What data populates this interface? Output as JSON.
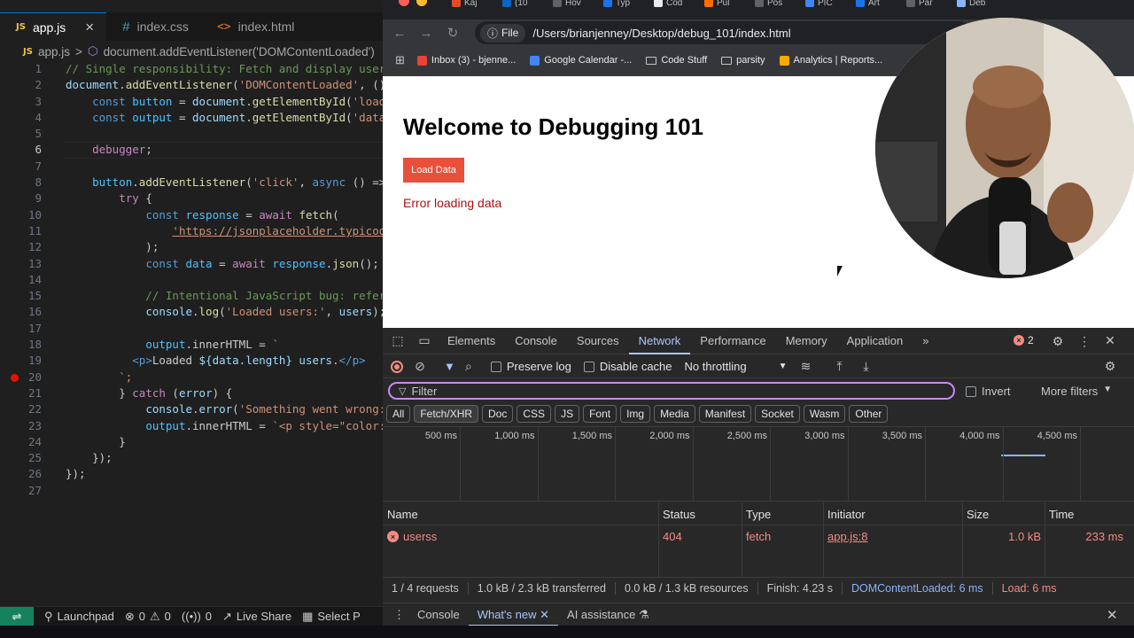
{
  "editor": {
    "tabs": [
      {
        "label": "app.js",
        "icon": "JS",
        "active": true
      },
      {
        "label": "index.css",
        "icon": "#"
      },
      {
        "label": "index.html",
        "icon": "<>"
      }
    ],
    "breadcrumb": {
      "file": "app.js",
      "sep": ">",
      "symbol": "document.addEventListener('DOMContentLoaded')"
    },
    "lines": [
      {
        "n": "1",
        "text": "// Single responsibility: Fetch and display user"
      },
      {
        "n": "2",
        "text": "document.addEventListener('DOMContentLoaded', () "
      },
      {
        "n": "3",
        "text": "    const button = document.getElementById('load-"
      },
      {
        "n": "4",
        "text": "    const output = document.getElementById('data-"
      },
      {
        "n": "5",
        "text": ""
      },
      {
        "n": "6",
        "text": "    debugger;"
      },
      {
        "n": "7",
        "text": ""
      },
      {
        "n": "8",
        "text": "    button.addEventListener('click', async () =>"
      },
      {
        "n": "9",
        "text": "        try {"
      },
      {
        "n": "10",
        "text": "            const response = await fetch("
      },
      {
        "n": "11",
        "text": "                'https://jsonplaceholder.typicode"
      },
      {
        "n": "12",
        "text": "            );"
      },
      {
        "n": "13",
        "text": "            const data = await response.json();"
      },
      {
        "n": "14",
        "text": ""
      },
      {
        "n": "15",
        "text": "            // Intentional JavaScript bug: refere"
      },
      {
        "n": "16",
        "text": "            console.log('Loaded users:', users);"
      },
      {
        "n": "17",
        "text": ""
      },
      {
        "n": "18",
        "text": "            output.innerHTML = `"
      },
      {
        "n": "19",
        "text": "          <p>Loaded ${data.length} users.</p>"
      },
      {
        "n": "20",
        "text": "        `;"
      },
      {
        "n": "21",
        "text": "        } catch (error) {"
      },
      {
        "n": "22",
        "text": "            console.error('Something went wrong:'"
      },
      {
        "n": "23",
        "text": "            output.innerHTML = `<p style=\"color:"
      },
      {
        "n": "24",
        "text": "        }"
      },
      {
        "n": "25",
        "text": "    });"
      },
      {
        "n": "26",
        "text": "});"
      },
      {
        "n": "27",
        "text": ""
      }
    ],
    "current_line": "6",
    "breakpoint_line": "20",
    "status_bar": {
      "launchpad": "Launchpad",
      "errors": "0",
      "warnings": "0",
      "ports": "0",
      "live_share": "Live Share",
      "select": "Select P"
    }
  },
  "browser": {
    "tabs": [
      "Kaj",
      "(10",
      "Hov",
      "Typ",
      "Cod",
      "Pul",
      "Pos",
      "PIC",
      "Art",
      "Par",
      "Deb"
    ],
    "address": {
      "chip": "File",
      "url": "/Users/brianjenney/Desktop/debug_101/index.html"
    },
    "bookmarks": [
      {
        "label": "Inbox (3) - bjenne...",
        "type": "gmail"
      },
      {
        "label": "Google Calendar -...",
        "type": "calendar"
      },
      {
        "label": "Code Stuff",
        "type": "folder"
      },
      {
        "label": "parsity",
        "type": "folder"
      },
      {
        "label": "Analytics | Reports...",
        "type": "analytics"
      },
      {
        "label": "arks",
        "type": "text"
      }
    ],
    "page": {
      "heading": "Welcome to Debugging 101",
      "button": "Load Data",
      "error": "Error loading data"
    }
  },
  "devtools": {
    "tabs": [
      "Elements",
      "Console",
      "Sources",
      "Network",
      "Performance",
      "Memory",
      "Application"
    ],
    "active_tab": "Network",
    "more": "»",
    "error_count": "2",
    "toolbar": {
      "preserve_log": "Preserve log",
      "disable_cache": "Disable cache",
      "throttling": "No throttling"
    },
    "filter": {
      "placeholder": "Filter",
      "invert": "Invert",
      "more_filters": "More filters"
    },
    "types": [
      "All",
      "Fetch/XHR",
      "Doc",
      "CSS",
      "JS",
      "Font",
      "Img",
      "Media",
      "Manifest",
      "Socket",
      "Wasm",
      "Other"
    ],
    "active_type": "Fetch/XHR",
    "timeline_ticks": [
      "500 ms",
      "1,000 ms",
      "1,500 ms",
      "2,000 ms",
      "2,500 ms",
      "3,000 ms",
      "3,500 ms",
      "4,000 ms",
      "4,500 ms",
      "5,0"
    ],
    "table": {
      "headers": [
        "Name",
        "Status",
        "Type",
        "Initiator",
        "Size",
        "Time"
      ],
      "rows": [
        {
          "name": "userss",
          "status": "404",
          "type": "fetch",
          "initiator": "app.js:8",
          "size": "1.0 kB",
          "time": "233 ms"
        }
      ]
    },
    "summary": {
      "requests": "1 / 4 requests",
      "transferred": "1.0 kB / 2.3 kB transferred",
      "resources": "0.0 kB / 1.3 kB resources",
      "finish": "Finish: 4.23 s",
      "dcl": "DOMContentLoaded: 6 ms",
      "load": "Load: 6 ms"
    },
    "drawer": {
      "console": "Console",
      "whats_new": "What's new",
      "ai": "AI assistance"
    }
  },
  "colors": {
    "accent": "#a8c7fa",
    "error": "#f28b82",
    "page_button": "#e8503a",
    "page_error": "#aa1111"
  }
}
